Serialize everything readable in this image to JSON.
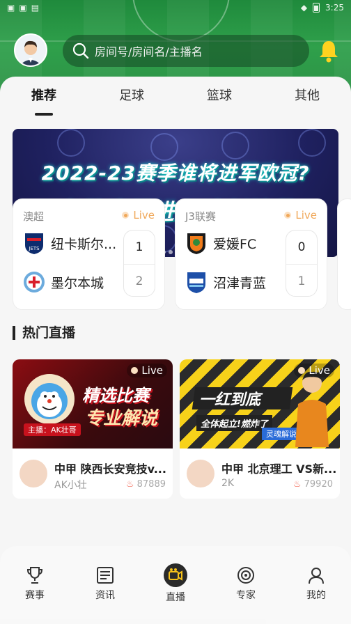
{
  "statusbar": {
    "time": "3:25"
  },
  "search": {
    "placeholder": "房间号/房间名/主播名"
  },
  "tabs": [
    {
      "label": "推荐",
      "active": true
    },
    {
      "label": "足球",
      "active": false
    },
    {
      "label": "篮球",
      "active": false
    },
    {
      "label": "其他",
      "active": false
    }
  ],
  "banner": {
    "line1": "2022-23赛季谁将进军欧冠?",
    "line2": "各路豪强进入冲刺阶段"
  },
  "matches": [
    {
      "league": "澳超",
      "status": "Live",
      "home": "纽卡斯尔...",
      "away": "墨尔本城",
      "home_score": "1",
      "away_score": "2"
    },
    {
      "league": "J3联赛",
      "status": "Live",
      "home": "爱媛FC",
      "away": "沼津青蓝",
      "home_score": "0",
      "away_score": "1"
    }
  ],
  "section_title": "热门直播",
  "live_cards": [
    {
      "status": "Live",
      "thumb_line1": "精选比赛",
      "thumb_line2": "专业解说",
      "anchor_tag": "主播：AK壮哥",
      "title": "中甲 陕西长安竞技v...",
      "anchor": "AK小壮",
      "heat": "87889"
    },
    {
      "status": "Live",
      "thumb_line1": "一红到底",
      "thumb_line2": "全体起立!燃炸了",
      "anchor_tag": "灵魂解说",
      "title": "中甲 北京理工 VS新...",
      "anchor": "2K",
      "heat": "79920"
    }
  ],
  "nav": [
    {
      "label": "赛事",
      "icon": "trophy-icon"
    },
    {
      "label": "资讯",
      "icon": "news-icon"
    },
    {
      "label": "直播",
      "icon": "live-camera-icon",
      "active": true
    },
    {
      "label": "专家",
      "icon": "target-icon"
    },
    {
      "label": "我的",
      "icon": "user-icon"
    }
  ],
  "colors": {
    "accent": "#f0a85a",
    "field_green": "#2fa04b",
    "banner_bg": "#1f2160"
  }
}
